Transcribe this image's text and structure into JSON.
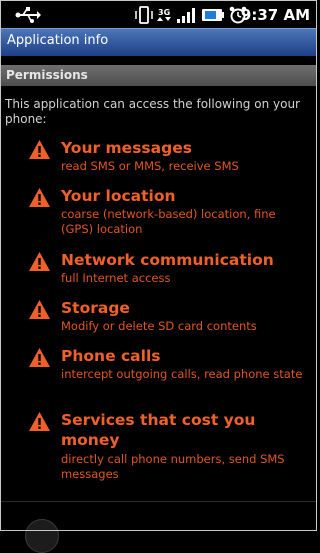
{
  "status_bar": {
    "time": "9:37 AM",
    "icons": [
      "usb-icon",
      "vibrate-icon",
      "data-3g-icon",
      "signal-icon",
      "battery-icon",
      "alarm-icon"
    ]
  },
  "title_bar": {
    "title": "Application info"
  },
  "permissions": {
    "header": "Permissions",
    "intro": "This application can access the following on your phone:",
    "items": [
      {
        "title": "Your messages",
        "description": "read SMS or MMS, receive SMS"
      },
      {
        "title": "Your location",
        "description": "coarse (network-based) location, fine (GPS) location"
      },
      {
        "title": "Network communication",
        "description": "full Internet access"
      },
      {
        "title": "Storage",
        "description": "Modify or delete SD card contents"
      },
      {
        "title": "Phone calls",
        "description": "intercept outgoing calls, read phone state"
      },
      {
        "title": "Services that cost you money",
        "description": "directly call phone numbers, send SMS messages"
      }
    ]
  },
  "colors": {
    "accent_orange": "#f0612a",
    "title_bar_blue": "#2b4f96",
    "section_gray": "#5e5e5e"
  }
}
